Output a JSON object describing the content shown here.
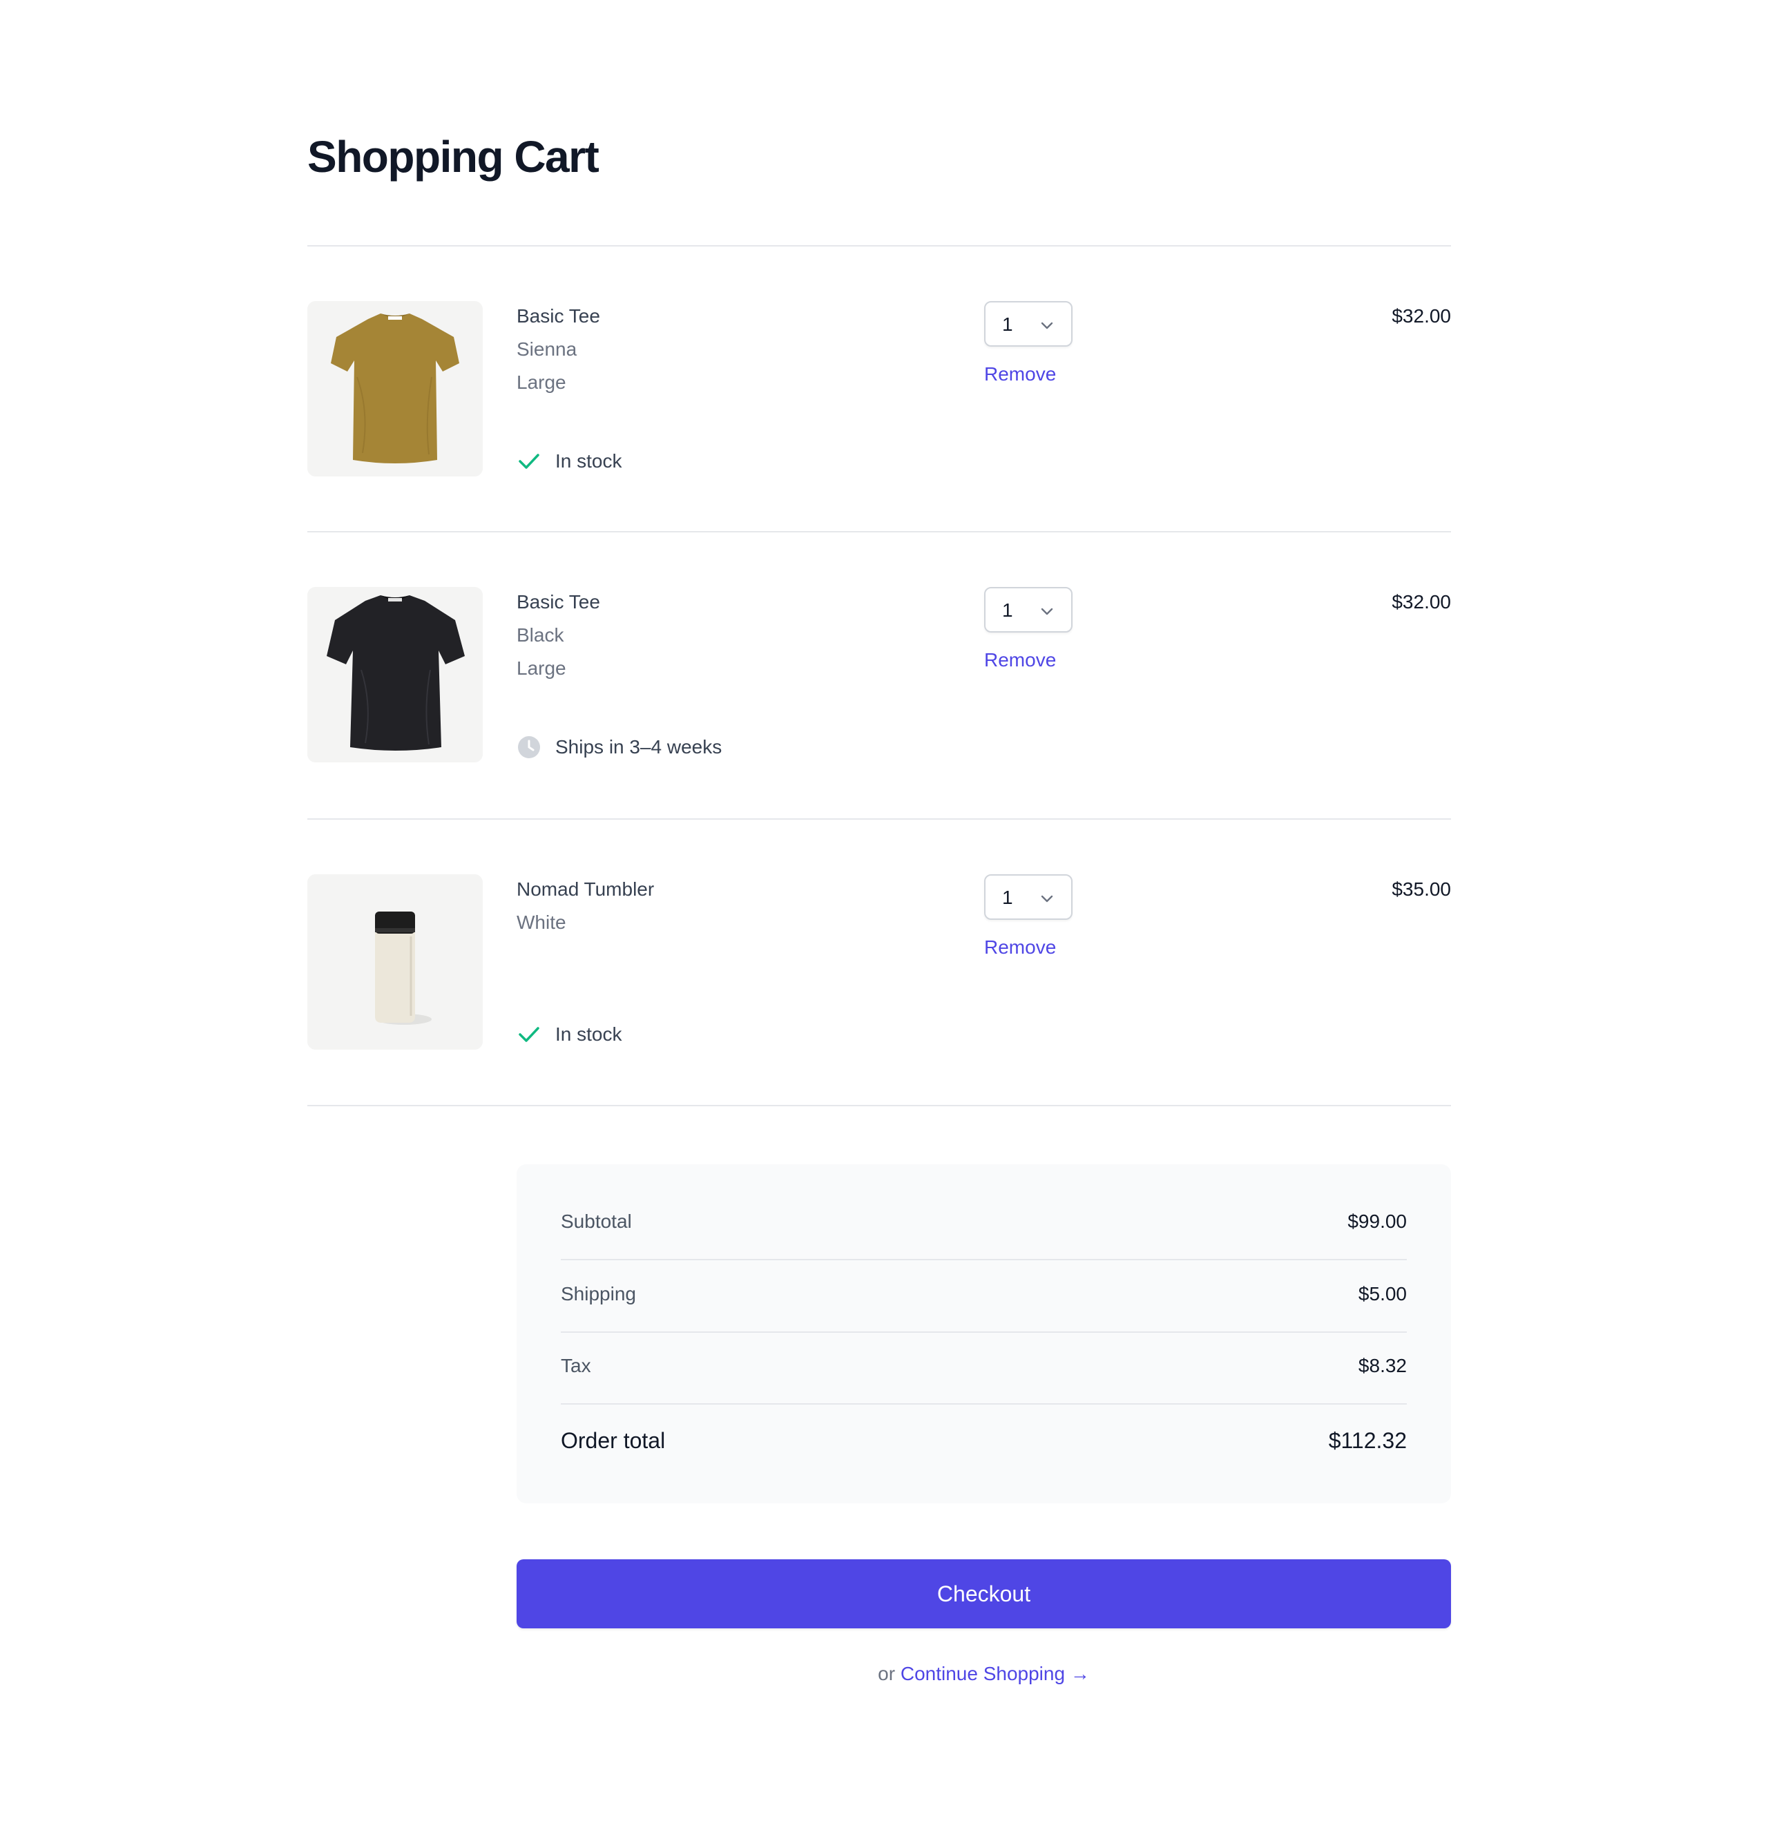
{
  "page_title": "Shopping Cart",
  "items": [
    {
      "name": "Basic Tee",
      "color": "Sienna",
      "size": "Large",
      "quantity": "1",
      "remove_label": "Remove",
      "price": "$32.00",
      "status": "In stock",
      "status_icon": "check-icon",
      "image_icon": "tshirt-sienna"
    },
    {
      "name": "Basic Tee",
      "color": "Black",
      "size": "Large",
      "quantity": "1",
      "remove_label": "Remove",
      "price": "$32.00",
      "status": "Ships in 3–4 weeks",
      "status_icon": "clock-icon",
      "image_icon": "tshirt-black"
    },
    {
      "name": "Nomad Tumbler",
      "color": "White",
      "quantity": "1",
      "remove_label": "Remove",
      "price": "$35.00",
      "status": "In stock",
      "status_icon": "check-icon",
      "image_icon": "tumbler-white"
    }
  ],
  "summary": {
    "subtotal_label": "Subtotal",
    "subtotal_value": "$99.00",
    "shipping_label": "Shipping",
    "shipping_value": "$5.00",
    "tax_label": "Tax",
    "tax_value": "$8.32",
    "total_label": "Order total",
    "total_value": "$112.32"
  },
  "checkout_label": "Checkout",
  "continue": {
    "prefix": "or",
    "link_label": "Continue Shopping →"
  },
  "colors": {
    "accent": "#4f46e5",
    "in_stock": "#10b981",
    "pending": "#d1d5db"
  }
}
